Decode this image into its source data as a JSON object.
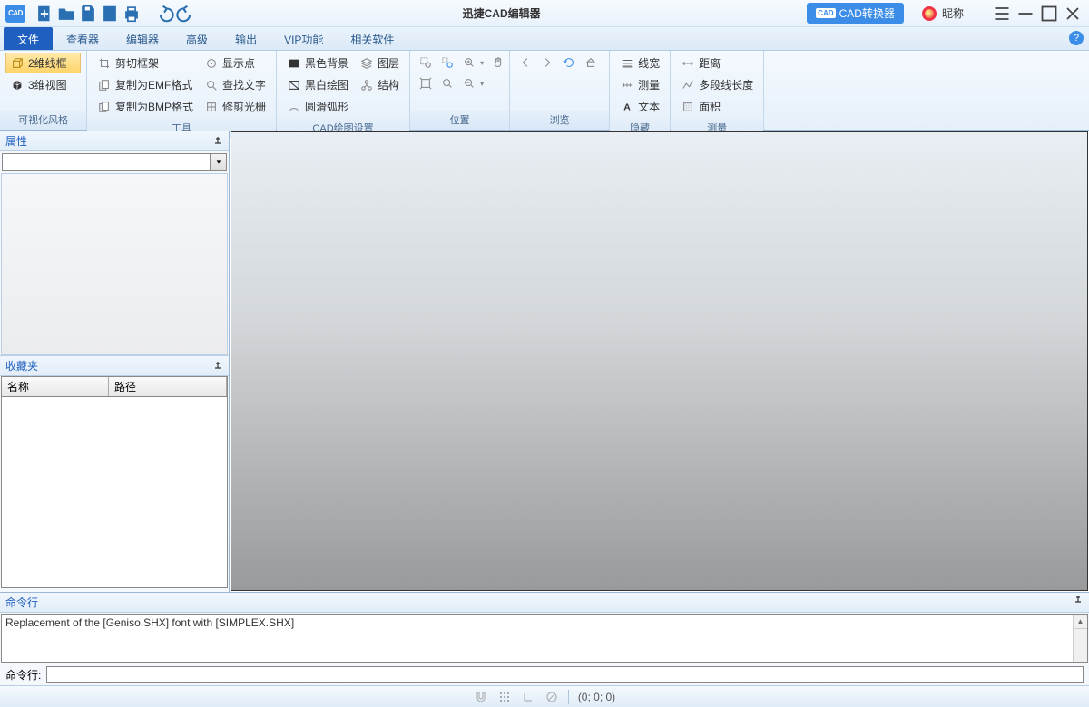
{
  "titlebar": {
    "logo_text": "CAD",
    "title": "迅捷CAD编辑器",
    "convert_label": "CAD转换器",
    "user_label": "昵称"
  },
  "tabs": {
    "items": [
      "文件",
      "查看器",
      "编辑器",
      "高级",
      "输出",
      "VIP功能",
      "相关软件"
    ],
    "active_index": 0
  },
  "ribbon": {
    "group0": {
      "label": "可视化风格",
      "btn0": "2维线框",
      "btn1": "3维视图"
    },
    "group1": {
      "label": "工具",
      "btn0": "剪切框架",
      "btn1": "复制为EMF格式",
      "btn2": "复制为BMP格式",
      "btn3": "显示点",
      "btn4": "查找文字",
      "btn5": "修剪光栅"
    },
    "group2": {
      "label": "CAD绘图设置",
      "btn0": "黑色背景",
      "btn1": "黑白绘图",
      "btn2": "圆滑弧形",
      "btn3": "图层",
      "btn4": "结构"
    },
    "group3": {
      "label": "位置"
    },
    "group4": {
      "label": "浏览"
    },
    "group5": {
      "label": "隐藏",
      "btn0": "线宽",
      "btn1": "测量",
      "btn2": "文本"
    },
    "group6": {
      "label": "测量",
      "btn0": "距离",
      "btn1": "多段线长度",
      "btn2": "面积"
    }
  },
  "sidebar": {
    "props_title": "属性",
    "fav_title": "收藏夹",
    "fav_col0": "名称",
    "fav_col1": "路径"
  },
  "command": {
    "title": "命令行",
    "log": "Replacement of the [Geniso.SHX] font with [SIMPLEX.SHX]",
    "prompt": "命令行:"
  },
  "statusbar": {
    "coords": "(0; 0; 0)"
  }
}
